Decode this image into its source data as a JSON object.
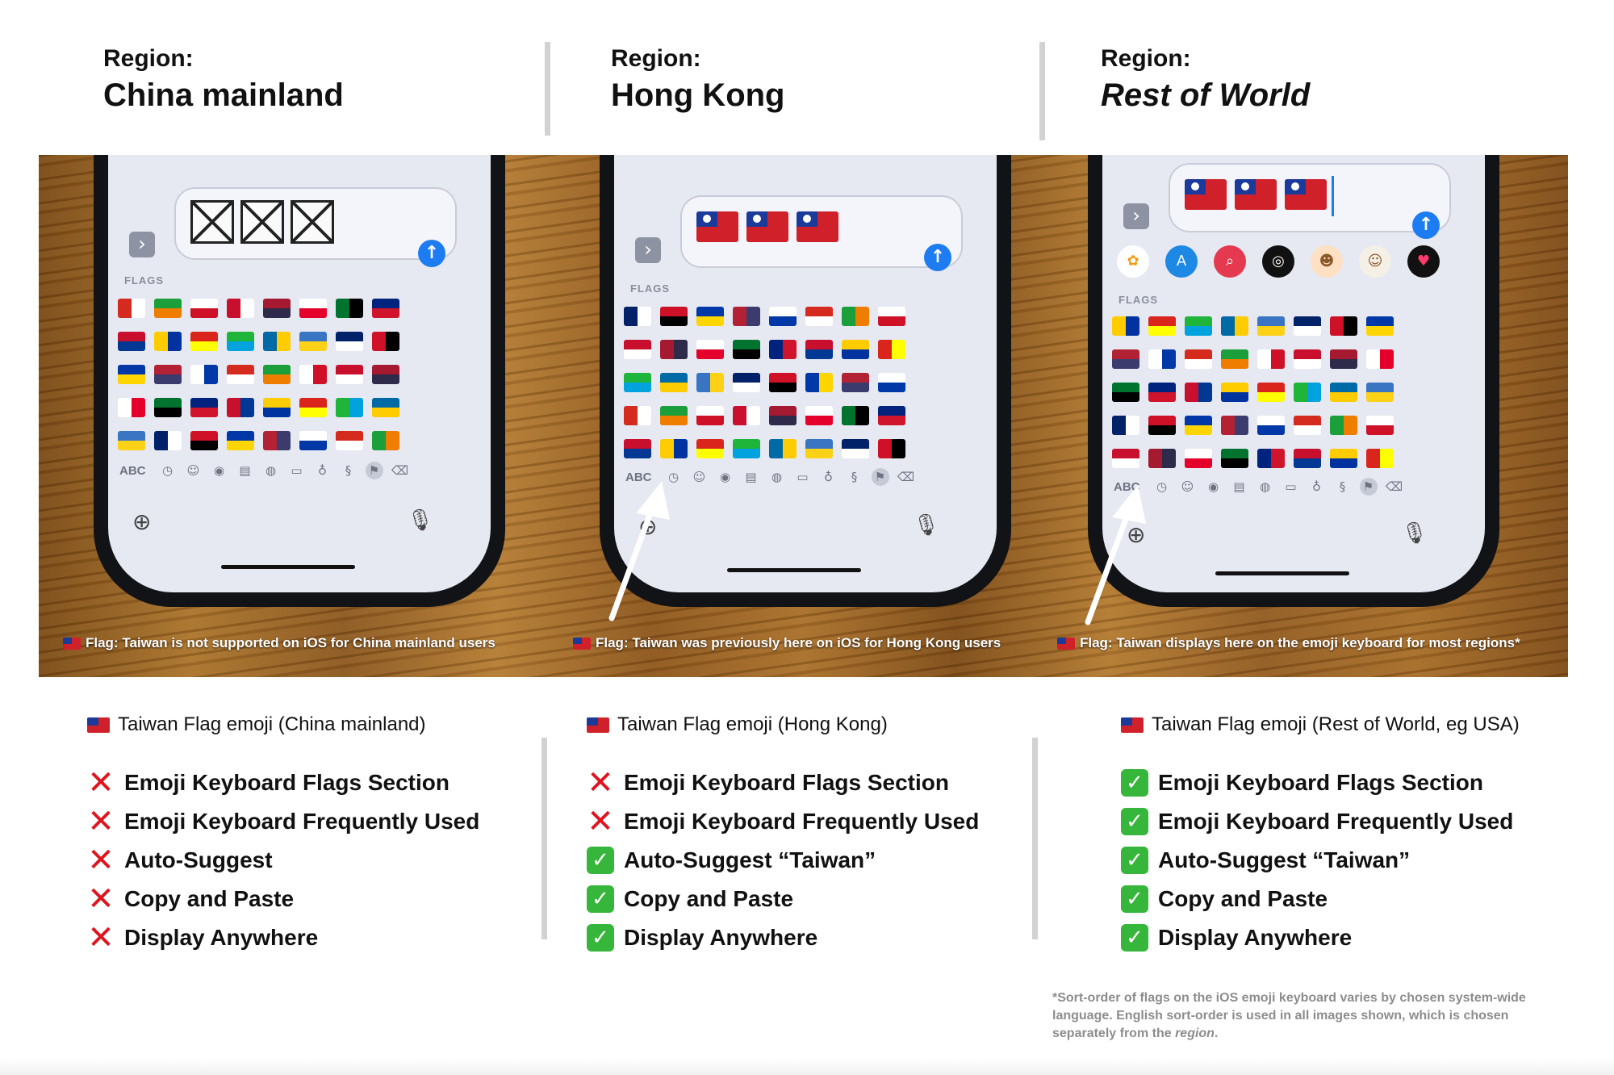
{
  "headers": [
    {
      "label": "Region:",
      "name": "China mainland"
    },
    {
      "label": "Region:",
      "name": "Hong Kong"
    },
    {
      "label": "Region:",
      "name": "Rest of World"
    }
  ],
  "keyboard": {
    "flags_label": "FLAGS",
    "abc_label": "ABC"
  },
  "captions": [
    "Flag: Taiwan is not supported on iOS for China mainland users",
    "Flag: Taiwan was previously here on iOS for Hong Kong users",
    "Flag: Taiwan displays here on the emoji keyboard for most regions*"
  ],
  "columns": [
    {
      "title": "Taiwan Flag emoji (China mainland)",
      "items": [
        {
          "label": "Emoji Keyboard Flags Section",
          "supported": false
        },
        {
          "label": "Emoji Keyboard Frequently Used",
          "supported": false
        },
        {
          "label": "Auto-Suggest",
          "supported": false
        },
        {
          "label": "Copy and Paste",
          "supported": false
        },
        {
          "label": "Display Anywhere",
          "supported": false
        }
      ]
    },
    {
      "title": "Taiwan Flag emoji (Hong Kong)",
      "items": [
        {
          "label": "Emoji Keyboard Flags Section",
          "supported": false
        },
        {
          "label": "Emoji Keyboard Frequently Used",
          "supported": false
        },
        {
          "label": "Auto-Suggest “Taiwan”",
          "supported": true
        },
        {
          "label": "Copy and Paste",
          "supported": true
        },
        {
          "label": "Display Anywhere",
          "supported": true
        }
      ]
    },
    {
      "title": "Taiwan Flag emoji (Rest of World, eg USA)",
      "items": [
        {
          "label": "Emoji Keyboard Flags Section",
          "supported": true
        },
        {
          "label": "Emoji Keyboard Frequently Used",
          "supported": true
        },
        {
          "label": "Auto-Suggest “Taiwan”",
          "supported": true
        },
        {
          "label": "Copy and Paste",
          "supported": true
        },
        {
          "label": "Display Anywhere",
          "supported": true
        }
      ]
    }
  ],
  "footnote": {
    "text_before": "*Sort-order of flags on the iOS emoji keyboard varies by chosen system-wide language. English sort-order is used in all images shown, which is chosen separately from the ",
    "emphasis": "region",
    "text_after": "."
  },
  "colors": {
    "cross": "#e0141e",
    "check": "#36b63a",
    "send_button": "#1e7cf2",
    "taiwan_red": "#d0212b",
    "taiwan_blue": "#1b3a9a"
  },
  "icons": {
    "cross": "cross-mark-icon",
    "check": "check-mark-icon",
    "missing_glyph": "missing-glyph-box-icon",
    "flag": "taiwan-flag-icon"
  }
}
